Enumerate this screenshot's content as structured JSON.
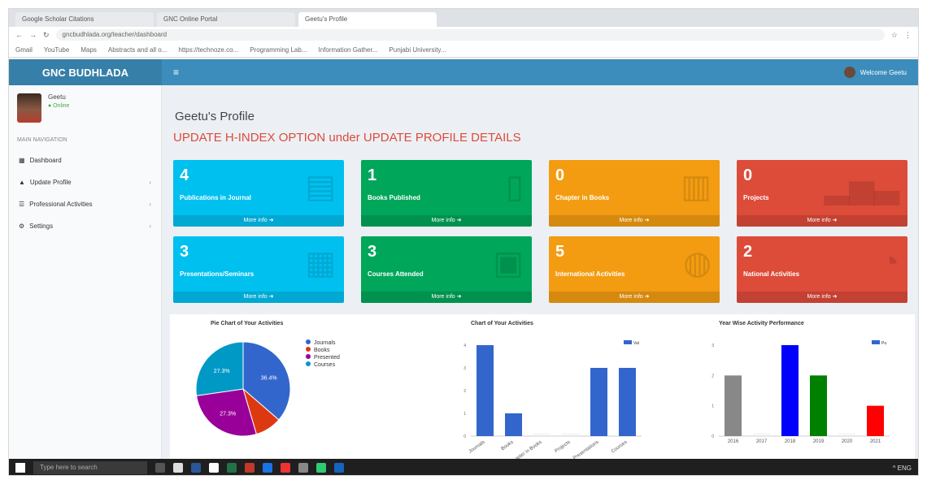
{
  "browser": {
    "tabs": [
      "Google Scholar Citations",
      "GNC Online Portal",
      "Geetu's Profile"
    ],
    "url": "gncbudhlada.org/teacher/dashboard",
    "bookmarks": [
      "Gmail",
      "YouTube",
      "Maps",
      "Abstracts and all o...",
      "https://technoze.co...",
      "Programming Lab...",
      "Information Gather...",
      "Punjabi University..."
    ]
  },
  "app": {
    "brand": "GNC BUDHLADA",
    "menu_icon": "≡",
    "welcome": "Welcome Geetu"
  },
  "sidebar": {
    "user_name": "Geetu",
    "status": "● Online",
    "nav_header": "MAIN NAVIGATION",
    "items": [
      {
        "label": "Dashboard",
        "icon": "dashboard-icon",
        "glyph": "▦",
        "chevron": ""
      },
      {
        "label": "Update Profile",
        "icon": "user-icon",
        "glyph": "▲",
        "chevron": "‹"
      },
      {
        "label": "Professional Activities",
        "icon": "list-icon",
        "glyph": "☰",
        "chevron": "‹"
      },
      {
        "label": "Settings",
        "icon": "gear-icon",
        "glyph": "⚙",
        "chevron": "‹"
      }
    ]
  },
  "main": {
    "page_title": "Geetu's Profile",
    "notice": "UPDATE H-INDEX OPTION under UPDATE PROFILE DETAILS",
    "more_info": "More info ➜",
    "boxes": [
      {
        "num": "4",
        "label": "Publications in Journal",
        "color": "aqua",
        "icon": "journal-icon",
        "glyph": "▤"
      },
      {
        "num": "1",
        "label": "Books Published",
        "color": "green",
        "icon": "book-icon",
        "glyph": "▯"
      },
      {
        "num": "0",
        "label": "Chapter in Books",
        "color": "yellow",
        "icon": "document-icon",
        "glyph": "▥"
      },
      {
        "num": "0",
        "label": "Projects",
        "color": "red",
        "icon": "bar-chart-icon",
        "glyph": "▂▅▃"
      },
      {
        "num": "3",
        "label": "Presentations/Seminars",
        "color": "aqua",
        "icon": "keyboard-icon",
        "glyph": "▦"
      },
      {
        "num": "3",
        "label": "Courses Attended",
        "color": "green",
        "icon": "clipboard-icon",
        "glyph": "▣"
      },
      {
        "num": "5",
        "label": "International Activities",
        "color": "yellow",
        "icon": "globe-icon",
        "glyph": "◍"
      },
      {
        "num": "2",
        "label": "National Activities",
        "color": "red",
        "icon": "pie-chart-icon",
        "glyph": "◔"
      }
    ]
  },
  "chart_data": [
    {
      "type": "pie",
      "title": "Pie Chart of Your Activities",
      "categories": [
        "Journals",
        "Books",
        "Presented",
        "Courses"
      ],
      "values": [
        36.4,
        9.1,
        27.3,
        27.3
      ],
      "labels": [
        "36.4%",
        "",
        "27.3%",
        "27.3%"
      ],
      "colors": [
        "#3366cc",
        "#dc3912",
        "#990099",
        "#0099c6"
      ],
      "legend": "right"
    },
    {
      "type": "bar",
      "title": "Chart of Your Activities",
      "categories": [
        "Journals",
        "Books",
        "Chapter in Books",
        "Projects",
        "Presentations",
        "Courses"
      ],
      "values": [
        4,
        1,
        0,
        0,
        3,
        3
      ],
      "ylim": [
        0,
        4
      ],
      "legend_label": "Val",
      "color": "#3366cc"
    },
    {
      "type": "bar",
      "title": "Year Wise Activity Performance",
      "categories": [
        "2016",
        "2017",
        "2018",
        "2019",
        "2020",
        "2021"
      ],
      "values": [
        2,
        0,
        3,
        2,
        0,
        1
      ],
      "ylim": [
        0,
        3
      ],
      "legend_label": "Pu",
      "colors": [
        "#888888",
        "#bbbbbb",
        "#0000ff",
        "#008000",
        "#bbbbbb",
        "#ff0000"
      ]
    }
  ],
  "taskbar": {
    "search_placeholder": "Type here to search",
    "tray": "^ ENG"
  }
}
